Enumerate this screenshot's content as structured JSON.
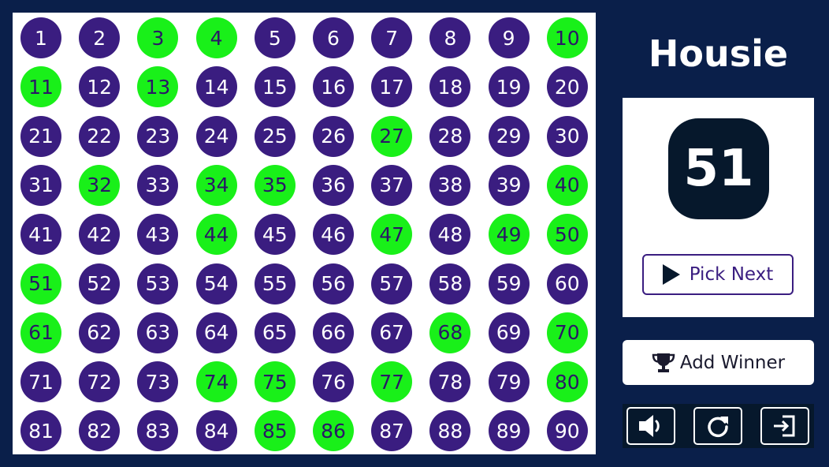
{
  "title": "Housie",
  "current_number": "51",
  "buttons": {
    "pick_next": "Pick Next",
    "add_winner": "Add Winner"
  },
  "controls": [
    {
      "name": "sound-button",
      "icon": "speaker-icon"
    },
    {
      "name": "reset-button",
      "icon": "refresh-icon"
    },
    {
      "name": "exit-button",
      "icon": "exit-icon"
    }
  ],
  "board": {
    "numbers": [
      1,
      2,
      3,
      4,
      5,
      6,
      7,
      8,
      9,
      10,
      11,
      12,
      13,
      14,
      15,
      16,
      17,
      18,
      19,
      20,
      21,
      22,
      23,
      24,
      25,
      26,
      27,
      28,
      29,
      30,
      31,
      32,
      33,
      34,
      35,
      36,
      37,
      38,
      39,
      40,
      41,
      42,
      43,
      44,
      45,
      46,
      47,
      48,
      49,
      50,
      51,
      52,
      53,
      54,
      55,
      56,
      57,
      58,
      59,
      60,
      61,
      62,
      63,
      64,
      65,
      66,
      67,
      68,
      69,
      70,
      71,
      72,
      73,
      74,
      75,
      76,
      77,
      78,
      79,
      80,
      81,
      82,
      83,
      84,
      85,
      86,
      87,
      88,
      89,
      90
    ],
    "called": [
      3,
      4,
      10,
      11,
      13,
      27,
      32,
      34,
      35,
      40,
      44,
      47,
      49,
      50,
      51,
      61,
      68,
      70,
      74,
      75,
      77,
      80,
      85,
      86
    ]
  },
  "colors": {
    "background": "#0a1f4a",
    "uncalled": "#3a1d80",
    "called": "#19f019",
    "accent": "#3a1d80",
    "current_ball": "#06182c"
  }
}
